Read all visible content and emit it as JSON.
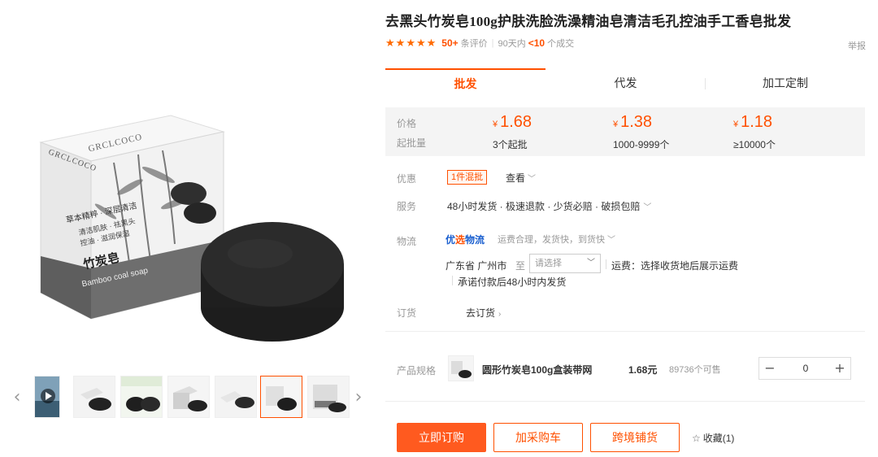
{
  "product": {
    "title": "去黑头竹炭皂100g护肤洗脸洗澡精油皂清洁毛孔控油手工香皂批发",
    "review_count": "50+",
    "review_text": "条评价",
    "period_text": "90天内",
    "sold_count": "<10",
    "sold_text": "个成交",
    "report_label": "举报"
  },
  "main_image": {
    "brand_text": "GRCLCOCO",
    "box_text_1": "草本精粹 · 深层清洁",
    "box_text_2": "清洁肌肤 · 祛黑头",
    "box_text_3": "控油 · 滋润保湿",
    "box_name": "竹炭皂",
    "box_name_en": "Bamboo coal soap",
    "colors": {
      "box": "#f1f1f1",
      "soap": "#262626",
      "ink": "#4a4a4a"
    }
  },
  "gallery": {
    "prev_icon": "‹",
    "next_icon": "›",
    "thumbnail_count": 7,
    "active_index": 5
  },
  "tabs": [
    {
      "label": "批发",
      "active": true
    },
    {
      "label": "代发",
      "active": false
    },
    {
      "label": "加工定制",
      "active": false
    }
  ],
  "pricing": {
    "price_label": "价格",
    "moq_label": "起批量",
    "currency": "¥",
    "tiers": [
      {
        "price": "1.68",
        "qty": "3个起批"
      },
      {
        "price": "1.38",
        "qty": "1000-9999个"
      },
      {
        "price": "1.18",
        "qty": "≥10000个"
      }
    ]
  },
  "promo": {
    "label": "优惠",
    "tag": "1件混批",
    "view": "查看"
  },
  "service": {
    "label": "服务",
    "text": "48小时发货 · 极速退款 · 少货必赔 · 破损包赔"
  },
  "logistics": {
    "label": "物流",
    "brand_prefix": "优",
    "brand_em": "选",
    "brand_suffix": "物流",
    "desc": "运费合理，发货快，到货快",
    "from": "广东省 广州市",
    "to": "至",
    "select_placeholder": "请选择",
    "freight": "运费：选择收货地后展示运费",
    "promise": "承诺付款后48小时内发货"
  },
  "order": {
    "label": "订货",
    "link": "去订货"
  },
  "sku": {
    "label": "产品规格",
    "name": "圆形竹炭皂100g盒装带网",
    "price": "1.68元",
    "stock": "89736个可售",
    "quantity": "0",
    "minus": "−",
    "plus": "+"
  },
  "actions": {
    "buy": "立即订购",
    "cart": "加采购车",
    "crossborder": "跨境铺货",
    "fav": "收藏(1)"
  },
  "theme": {
    "accent": "#ff5000",
    "brand_blue": "#1a5fcf"
  }
}
